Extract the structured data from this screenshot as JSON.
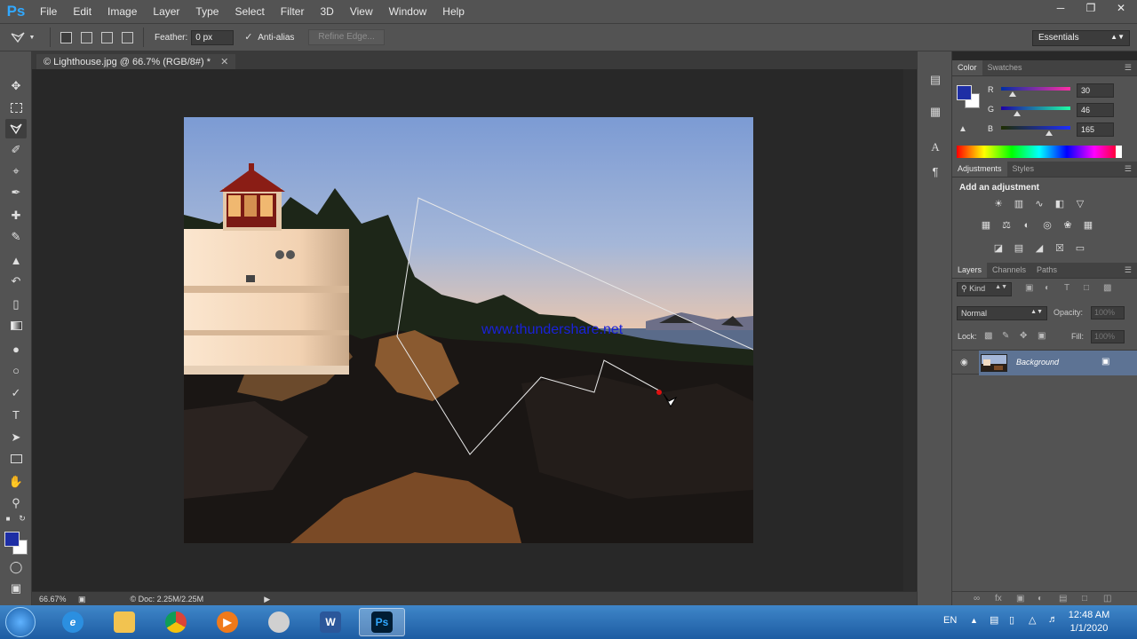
{
  "app": {
    "logo": "Ps",
    "menus": [
      "File",
      "Edit",
      "Image",
      "Layer",
      "Type",
      "Select",
      "Filter",
      "3D",
      "View",
      "Window",
      "Help"
    ],
    "window_controls": [
      "minimize",
      "restore",
      "close"
    ]
  },
  "options": {
    "feather_label": "Feather:",
    "feather_value": "0 px",
    "antialias_label": "Anti-alias",
    "refine_edge_label": "Refine Edge...",
    "workspace": "Essentials"
  },
  "tools": [
    "move-icon",
    "marquee-icon",
    "polygonal-lasso-icon",
    "quick-selection-icon",
    "crop-icon",
    "eyedropper-icon",
    "spot-healing-icon",
    "brush-icon",
    "clone-stamp-icon",
    "history-brush-icon",
    "eraser-icon",
    "gradient-icon",
    "blur-icon",
    "dodge-icon",
    "pen-icon",
    "type-icon",
    "path-selection-icon",
    "rectangle-icon",
    "hand-icon",
    "zoom-icon"
  ],
  "colors": {
    "foreground": "#1e2ea5",
    "background": "#ffffff",
    "selection_layer": "#5d7394",
    "accent": "#31a8ff"
  },
  "document": {
    "tab_title": "© Lighthouse.jpg @ 66.7% (RGB/8#) *",
    "watermark": "www.thundershare.net",
    "zoom": "66.67%",
    "doc_info": "© Doc: 2.25M/2.25M"
  },
  "color_panel": {
    "tabs": [
      "Color",
      "Swatches"
    ],
    "channels": [
      {
        "label": "R",
        "value": "30",
        "fraction": 0.118
      },
      {
        "label": "G",
        "value": "46",
        "fraction": 0.18
      },
      {
        "label": "B",
        "value": "165",
        "fraction": 0.647
      }
    ]
  },
  "adjustments_panel": {
    "tabs": [
      "Adjustments",
      "Styles"
    ],
    "title": "Add an adjustment"
  },
  "layers_panel": {
    "tabs": [
      "Layers",
      "Channels",
      "Paths"
    ],
    "kind_label": "Kind",
    "blend_mode": "Normal",
    "opacity_label": "Opacity:",
    "opacity_value": "100%",
    "lock_label": "Lock:",
    "fill_label": "Fill:",
    "fill_value": "100%",
    "layers": [
      {
        "name": "Background",
        "locked": true,
        "visible": true
      }
    ]
  },
  "taskbar": {
    "apps": [
      "internet-explorer",
      "file-explorer",
      "chrome",
      "media-player",
      "app-unknown",
      "word",
      "photoshop"
    ],
    "language": "EN",
    "time": "12:48 AM",
    "date": "1/1/2020"
  }
}
